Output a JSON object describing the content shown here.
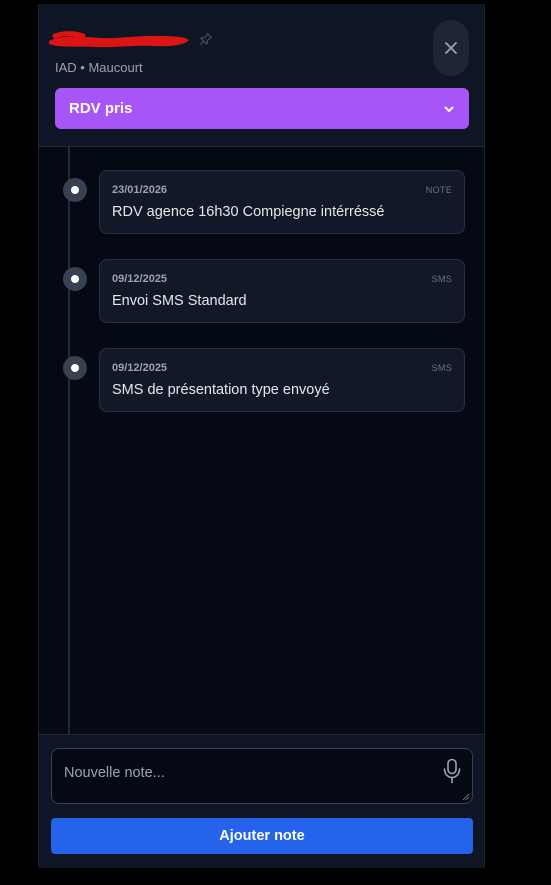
{
  "header": {
    "subtitle": "IAD • Maucourt",
    "status_select": {
      "value": "RDV pris",
      "color": "#a855f7"
    },
    "close_icon": "close-icon",
    "pin_icon": "pin-icon"
  },
  "timeline": {
    "items": [
      {
        "date": "23/01/2026",
        "type": "NOTE",
        "text": "RDV agence 16h30 Compiegne intérréssé"
      },
      {
        "date": "09/12/2025",
        "type": "SMS",
        "text": "Envoi SMS Standard"
      },
      {
        "date": "09/12/2025",
        "type": "SMS",
        "text": "SMS de présentation type envoyé"
      }
    ]
  },
  "footer": {
    "note_placeholder": "Nouvelle note...",
    "mic_icon": "microphone-icon",
    "add_button_label": "Ajouter note",
    "add_button_color": "#2563eb"
  }
}
